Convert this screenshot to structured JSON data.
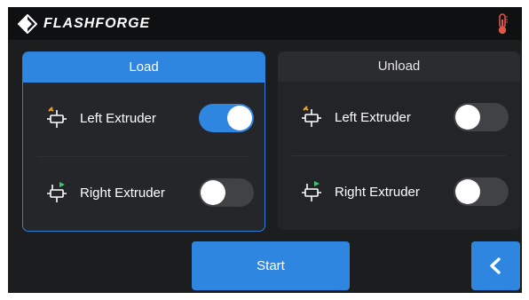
{
  "header": {
    "brand": "FLASHFORGE",
    "logo_icon": "flashforge-logo-icon",
    "status_icon": "thermometer-icon"
  },
  "load_panel": {
    "title": "Load",
    "rows": [
      {
        "label": "Left Extruder",
        "icon": "left-extruder-icon",
        "enabled": true
      },
      {
        "label": "Right Extruder",
        "icon": "right-extruder-icon",
        "enabled": false
      }
    ]
  },
  "unload_panel": {
    "title": "Unload",
    "rows": [
      {
        "label": "Left Extruder",
        "icon": "left-extruder-icon",
        "enabled": false
      },
      {
        "label": "Right Extruder",
        "icon": "right-extruder-icon",
        "enabled": false
      }
    ]
  },
  "actions": {
    "start_label": "Start",
    "back_icon": "chevron-left-icon"
  },
  "colors": {
    "accent": "#2f86e0",
    "background": "#1c1d1f",
    "header": "#0f1012",
    "left_marker": "#f0a030",
    "right_marker": "#3cc86a",
    "thermometer": "#e0554a"
  }
}
